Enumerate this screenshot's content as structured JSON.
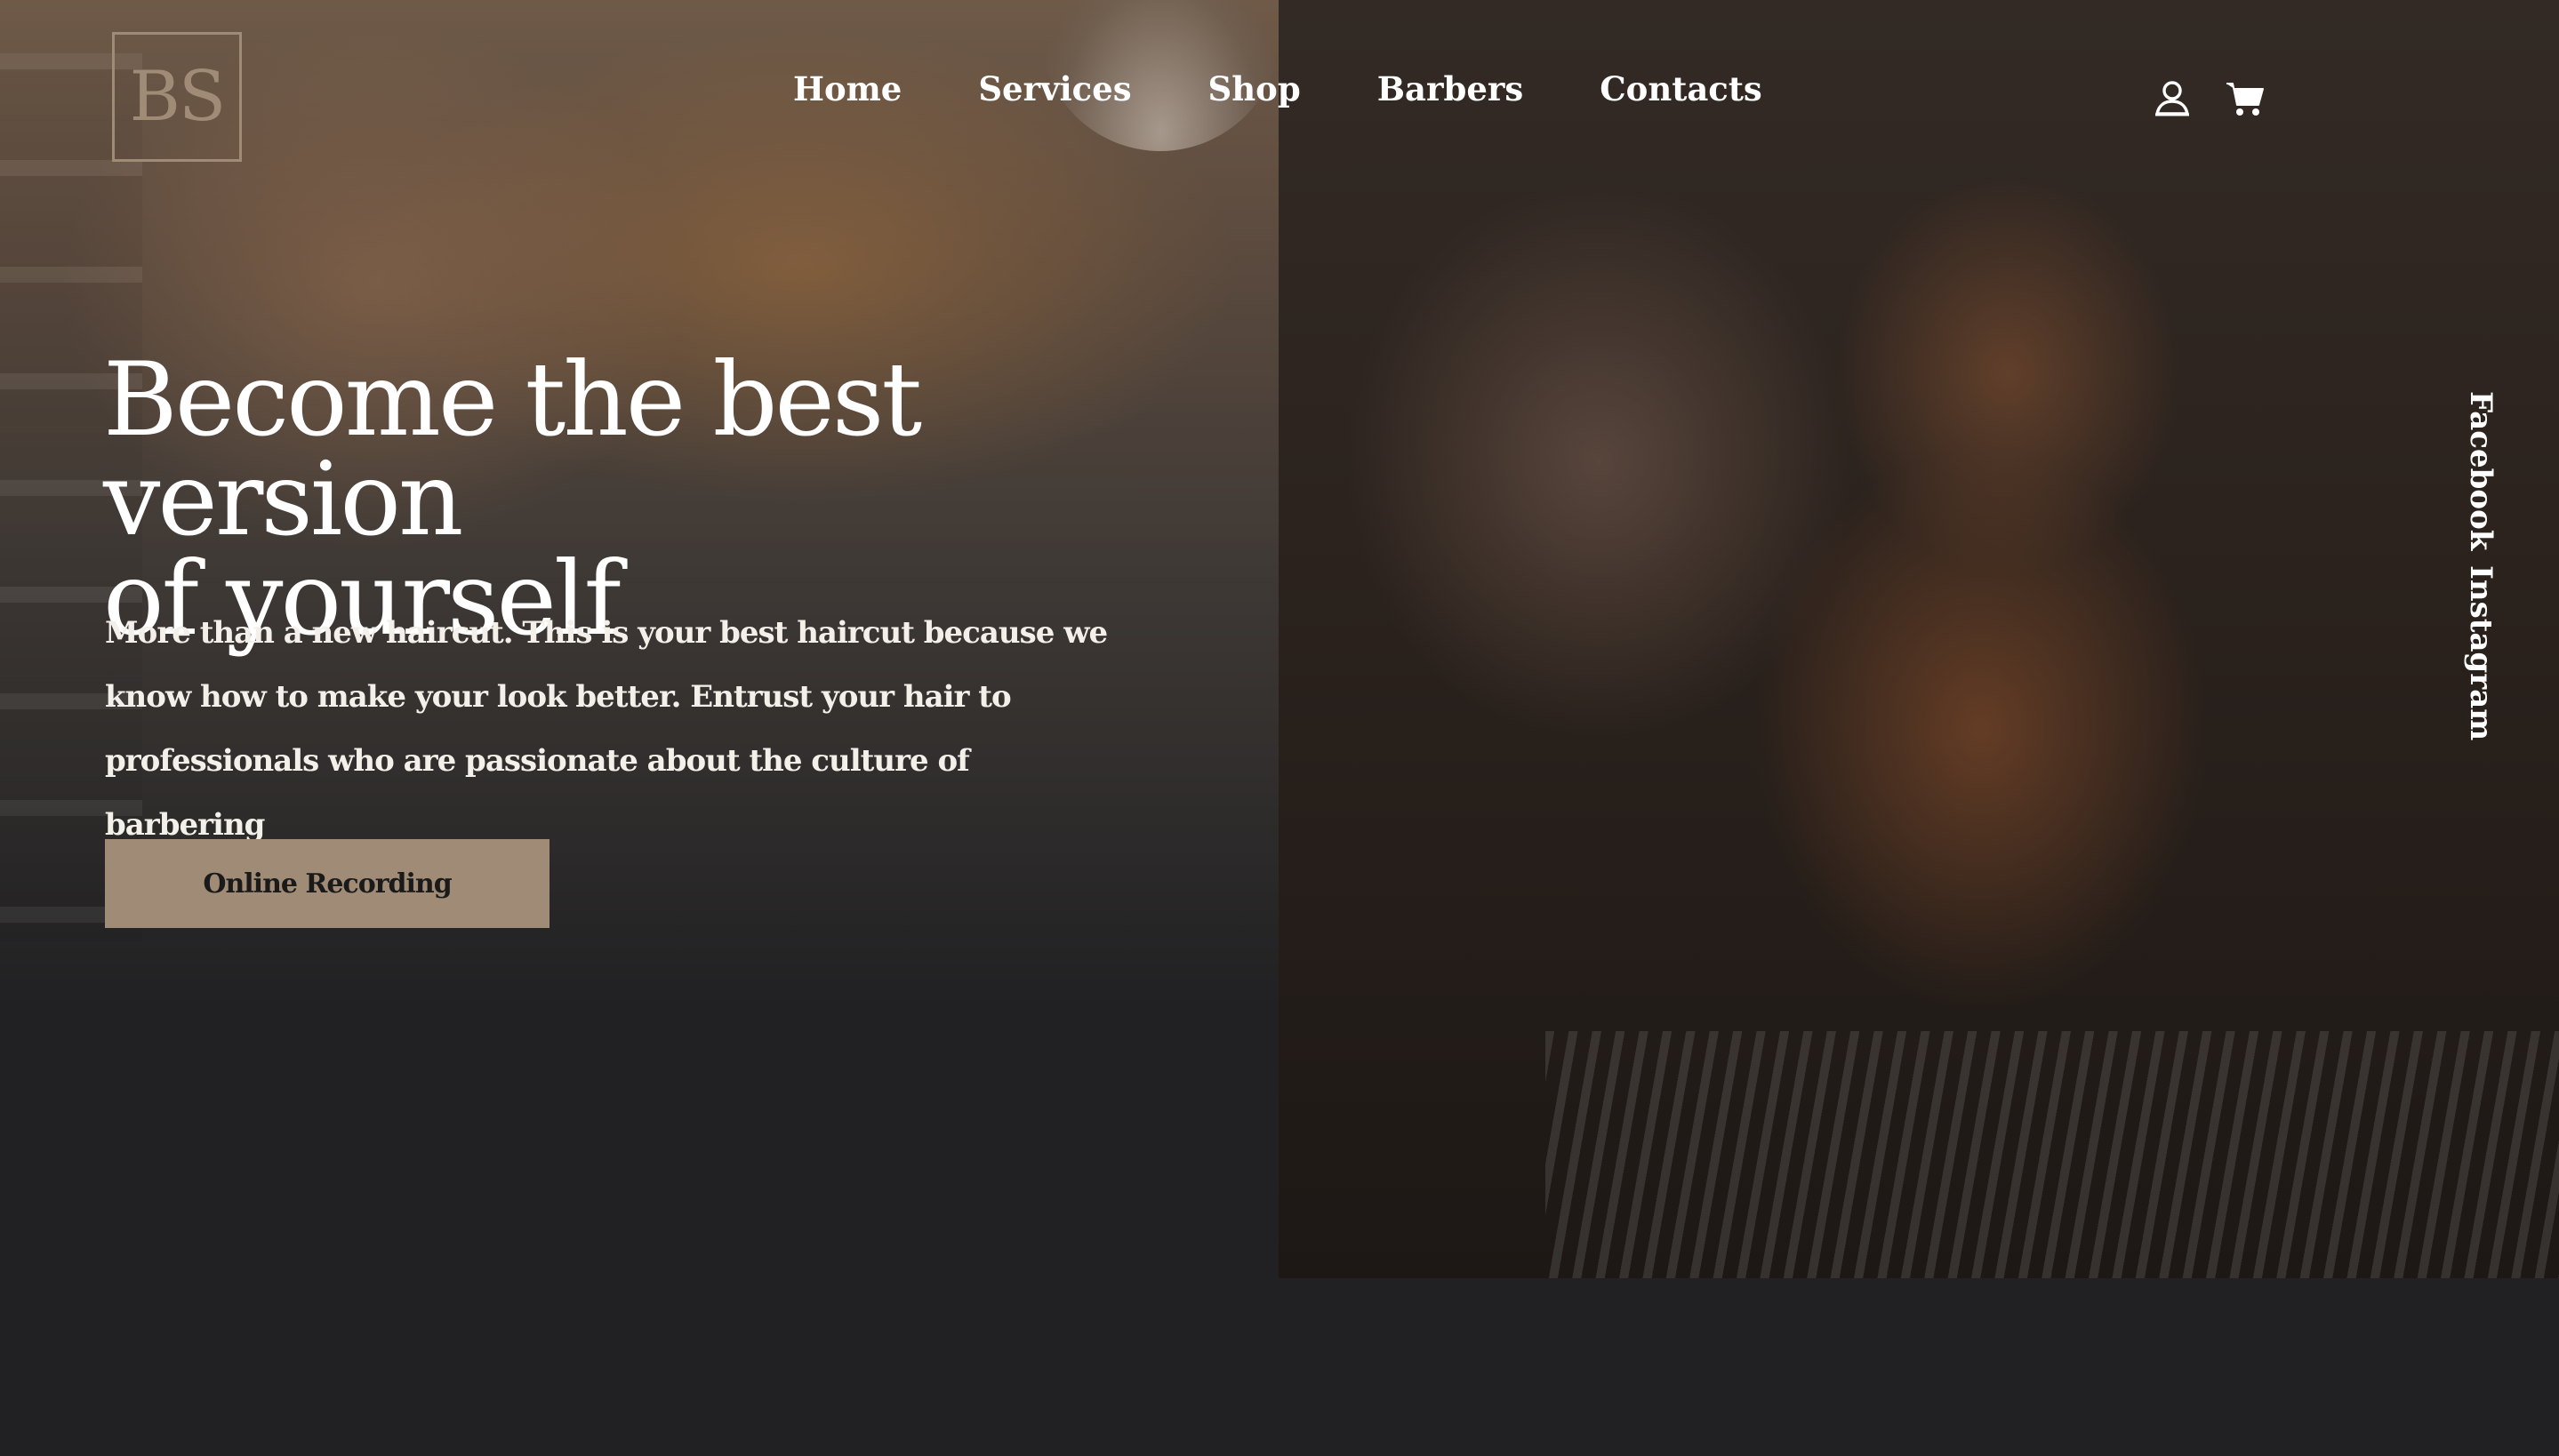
{
  "brand": {
    "logo_text": "BS",
    "accent_color": "#a08c76"
  },
  "nav": {
    "items": [
      {
        "label": "Home"
      },
      {
        "label": "Services"
      },
      {
        "label": "Shop"
      },
      {
        "label": "Barbers"
      },
      {
        "label": "Contacts"
      }
    ]
  },
  "header_icons": {
    "account": "user-icon",
    "cart": "cart-icon"
  },
  "hero": {
    "title_line1": "Become the best version",
    "title_line2": "of yourself",
    "description": "More than a new haircut. This is your best haircut because we know how to make your look better. Entrust your hair to professionals who are passionate about the culture of barbering",
    "cta_label": "Online Recording"
  },
  "social": {
    "links": [
      {
        "label": "Facebook"
      },
      {
        "label": "Instagram"
      }
    ]
  },
  "colors": {
    "page_bg": "#212123",
    "button_bg": "#a08c76",
    "text": "#ffffff"
  }
}
